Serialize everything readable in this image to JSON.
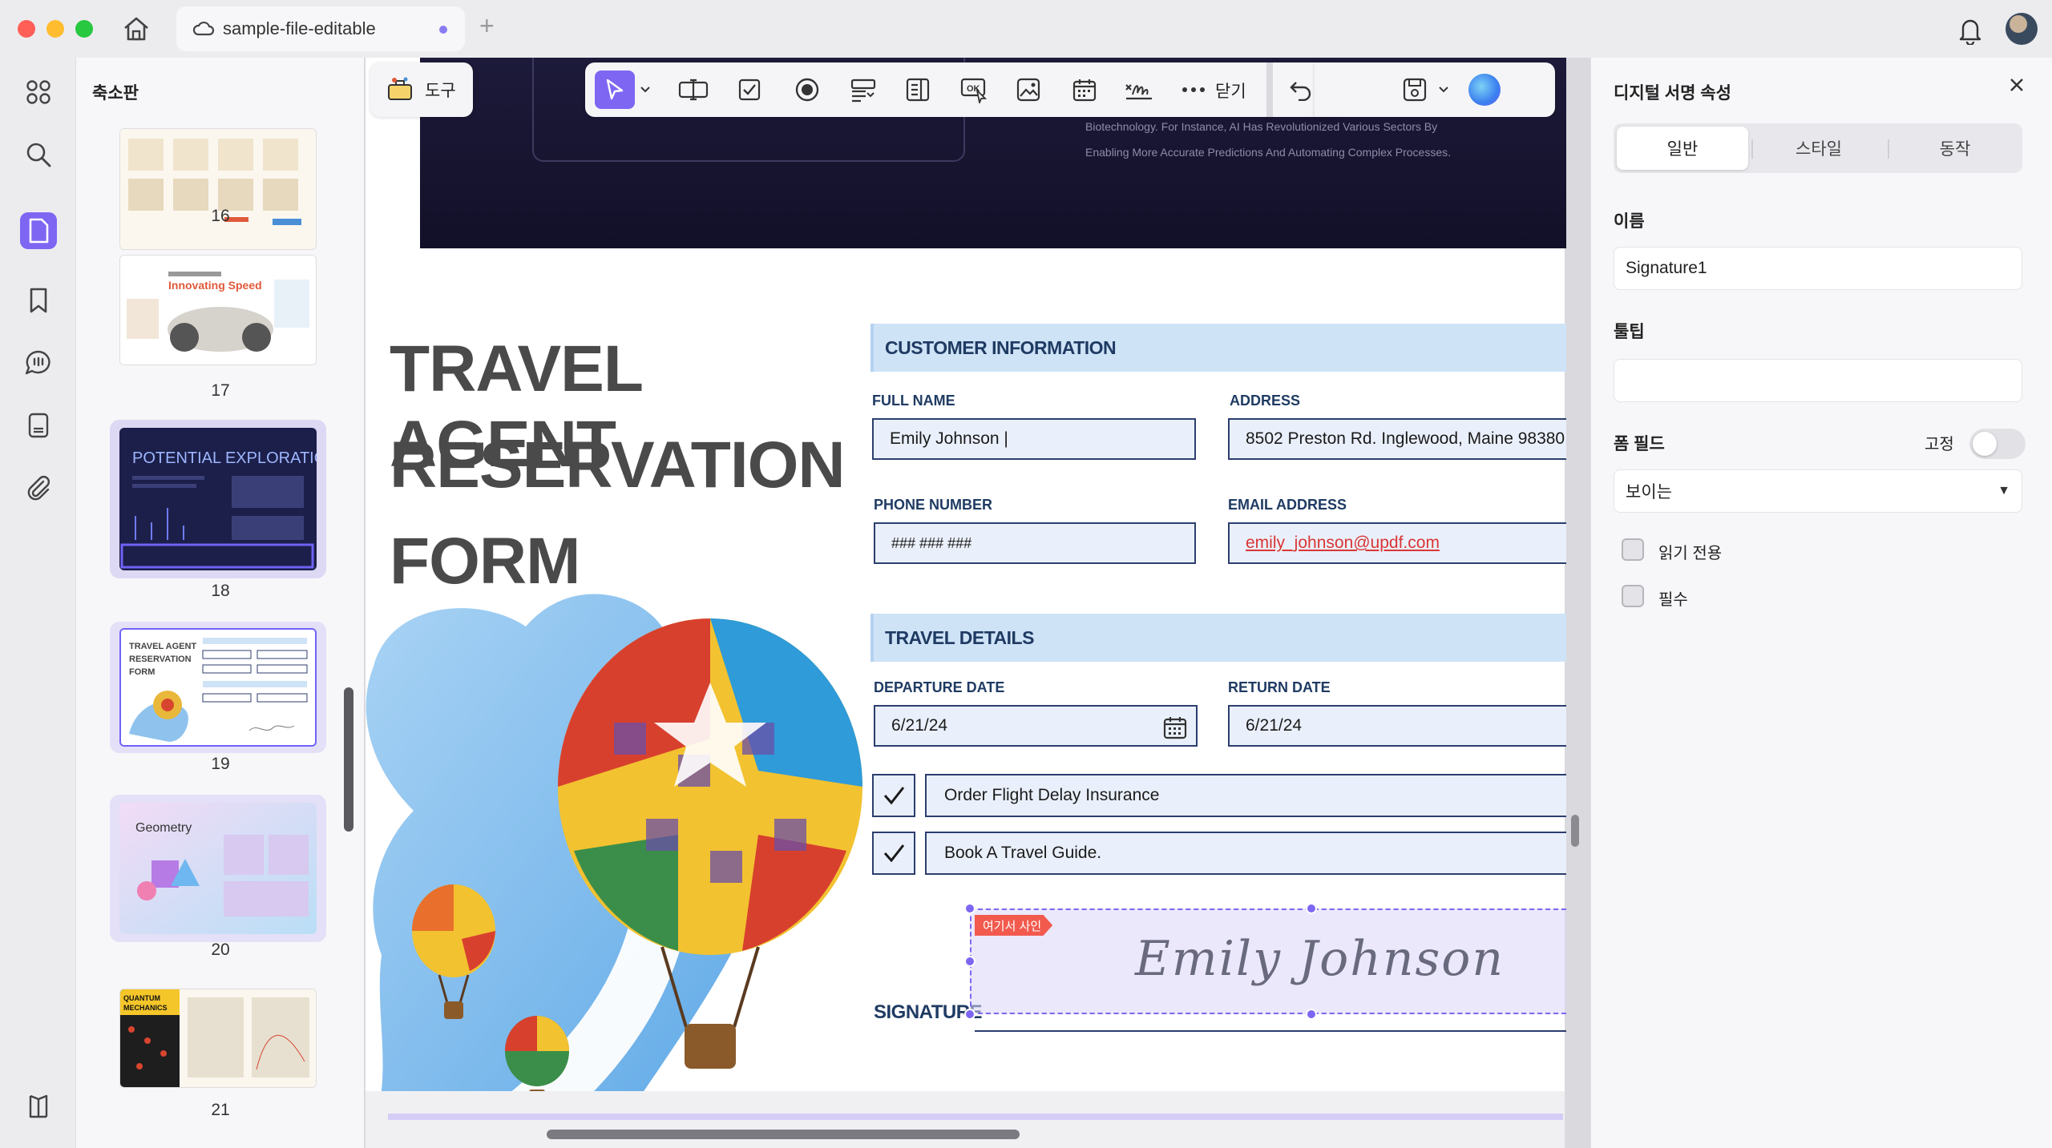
{
  "window": {
    "tab_title": "sample-file-editable",
    "new_tab": "+"
  },
  "rail": {
    "icons": [
      "grid-icon",
      "search-icon",
      "pages-icon",
      "bookmark-icon",
      "comment-icon",
      "document-icon",
      "attachment-icon",
      "layers-icon"
    ]
  },
  "thumbnails": {
    "title": "축소판",
    "pages": [
      {
        "num": "16"
      },
      {
        "num": "17",
        "heading": "Innovating Speed"
      },
      {
        "num": "18",
        "heading": "POTENTIAL EXPLORATION"
      },
      {
        "num": "19",
        "heading": "TRAVEL AGENT RESERVATION FORM"
      },
      {
        "num": "20",
        "heading": "Geometry"
      },
      {
        "num": "21",
        "heading": "QUANTUM MECHANICS"
      }
    ]
  },
  "toolbar": {
    "tools_label": "도구",
    "close_label": "닫기"
  },
  "banner": {
    "text": "Biotechnology. For Instance, AI Has Revolutionized Various Sectors By Enabling More Accurate Predictions And Automating Complex Processes."
  },
  "form": {
    "title_lines": [
      "TRAVEL AGENT",
      "RESERVATION",
      "FORM"
    ],
    "customer_section": "CUSTOMER INFORMATION",
    "full_name_label": "FULL NAME",
    "full_name_value": "Emily Johnson |",
    "address_label": "ADDRESS",
    "address_value": "8502 Preston Rd. Inglewood, Maine 98380",
    "phone_label": "PHONE NUMBER",
    "phone_value": "### ### ###",
    "email_label": "EMAIL ADDRESS",
    "email_value": "emily_johnson@updf.com",
    "travel_section": "TRAVEL DETAILS",
    "departure_label": "DEPARTURE DATE",
    "departure_value": "6/21/24",
    "return_label": "RETURN DATE",
    "return_value": "6/21/24",
    "options": [
      {
        "label": "Order Flight Delay Insurance",
        "checked": true
      },
      {
        "label": "Book A Travel Guide.",
        "checked": true
      }
    ],
    "signature_label": "SIGNATURE",
    "signature_tag": "여기서 사인",
    "signature_value": "Emily Johnson"
  },
  "properties": {
    "title": "디지털 서명 속성",
    "tabs": [
      "일반",
      "스타일",
      "동작"
    ],
    "active_tab": "일반",
    "name_label": "이름",
    "name_value": "Signature1",
    "tooltip_label": "툴팁",
    "tooltip_value": "",
    "form_field_label": "폼 필드",
    "fixed_label": "고정",
    "fixed_on": false,
    "visibility_value": "보이는",
    "readonly_label": "읽기 전용",
    "required_label": "필수"
  },
  "colors": {
    "accent": "#7e66f3",
    "section_bg": "#cfe3f7",
    "navy": "#1f3b63",
    "email_red": "#d93636"
  }
}
